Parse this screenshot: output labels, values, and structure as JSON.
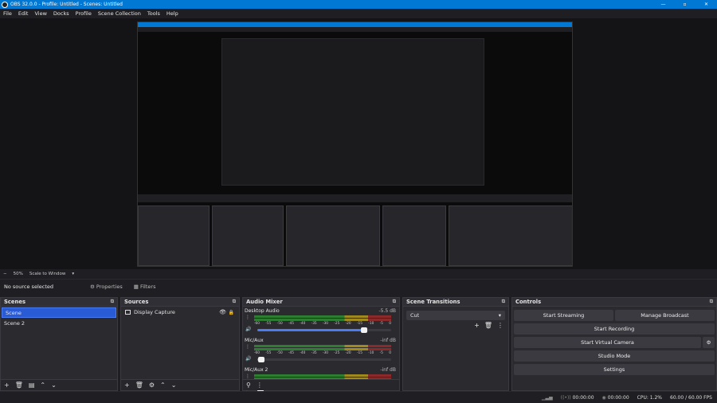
{
  "window": {
    "title": "OBS 32.0.0 - Profile: Untitled - Scenes: Untitled"
  },
  "menu": [
    "File",
    "Edit",
    "View",
    "Docks",
    "Profile",
    "Scene Collection",
    "Tools",
    "Help"
  ],
  "zoom": {
    "minus": "−",
    "value": "50%",
    "scale_mode": "Scale to Window"
  },
  "infobar": {
    "no_source": "No source selected",
    "properties": "Properties",
    "filters": "Filters"
  },
  "scenes": {
    "title": "Scenes",
    "items": [
      "Scene",
      "Scene 2"
    ]
  },
  "sources": {
    "title": "Sources",
    "items": [
      "Display Capture"
    ]
  },
  "mixer": {
    "title": "Audio Mixer",
    "channels": [
      {
        "name": "Desktop Audio",
        "db": "-5.5 dB",
        "level": 0.88,
        "volume": 0.8
      },
      {
        "name": "Mic/Aux",
        "db": "-inf dB",
        "level": 0.0,
        "volume": 0.03
      },
      {
        "name": "Mic/Aux 2",
        "db": "-inf dB",
        "level": 0.0,
        "volume": 0.0
      }
    ],
    "scale": [
      "-60",
      "-55",
      "-50",
      "-45",
      "-40",
      "-35",
      "-30",
      "-25",
      "-20",
      "-15",
      "-10",
      "-5",
      "0"
    ]
  },
  "transitions": {
    "title": "Scene Transitions",
    "selected": "Cut"
  },
  "controls": {
    "title": "Controls",
    "start_streaming": "Start Streaming",
    "manage_broadcast": "Manage Broadcast",
    "start_recording": "Start Recording",
    "start_virtual_camera": "Start Virtual Camera",
    "studio_mode": "Studio Mode",
    "settings": "Settings"
  },
  "status": {
    "stream_time": "00:00:00",
    "record_time": "00:00:00",
    "cpu": "CPU: 1.2%",
    "fps": "60.00 / 60.00 FPS"
  },
  "colors": {
    "accent": "#2a5bd6",
    "titlebar": "#0078d4",
    "panel": "#2a2a2f"
  }
}
